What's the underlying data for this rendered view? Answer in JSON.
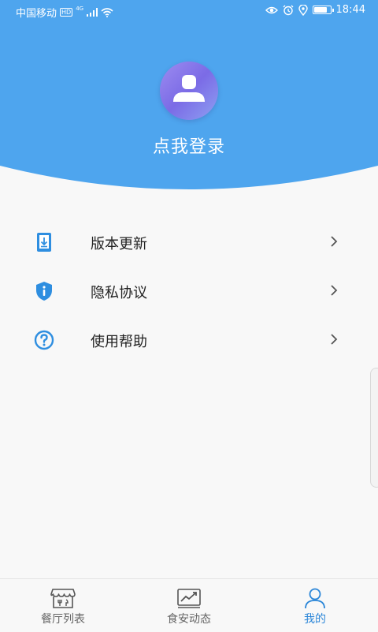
{
  "status_bar": {
    "carrier": "中国移动",
    "hd_badge": "HD",
    "network": "4G",
    "time": "18:44",
    "battery_level": 0.85,
    "icons": [
      "signal-icon",
      "wifi-icon",
      "eye-icon",
      "alarm-icon",
      "location-icon",
      "battery-icon"
    ]
  },
  "profile": {
    "login_label": "点我登录",
    "avatar_icon": "user-avatar-icon"
  },
  "menu": {
    "items": [
      {
        "label": "版本更新",
        "icon": "download-icon"
      },
      {
        "label": "隐私协议",
        "icon": "shield-info-icon"
      },
      {
        "label": "使用帮助",
        "icon": "help-icon"
      }
    ]
  },
  "bottom_nav": {
    "items": [
      {
        "label": "餐厅列表",
        "icon": "store-icon"
      },
      {
        "label": "食安动态",
        "icon": "trend-chart-icon"
      },
      {
        "label": "我的",
        "icon": "person-icon",
        "active": true
      }
    ]
  },
  "colors": {
    "header_blue": "#4ea5ee",
    "accent": "#2b86d8",
    "avatar_purple": "#8b7cec",
    "text": "#222222",
    "nav_inactive": "#666666"
  }
}
